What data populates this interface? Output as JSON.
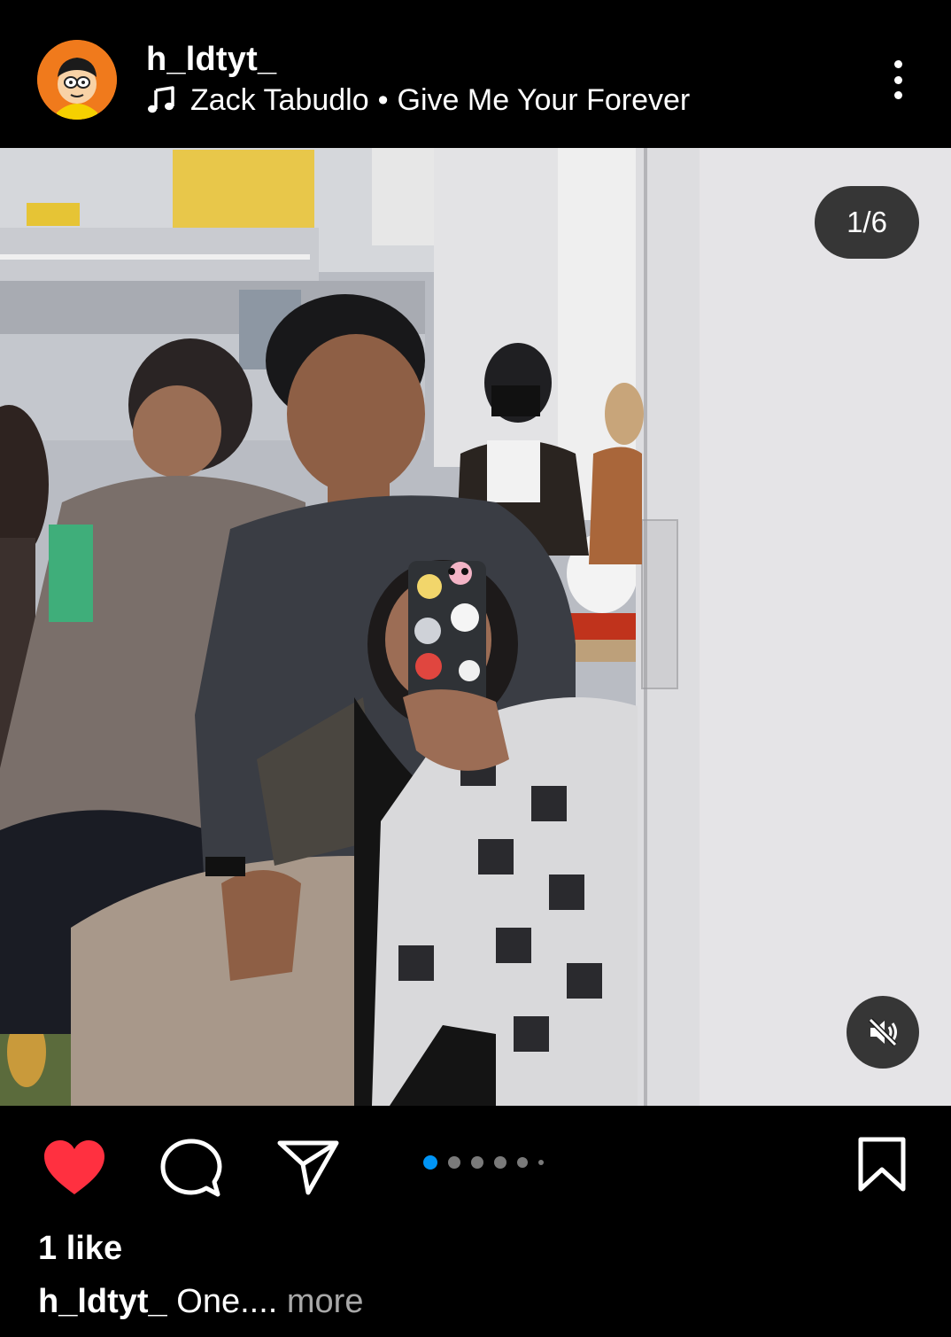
{
  "post": {
    "username": "h_ldtyt_",
    "music": {
      "artist": "Zack Tabudlo",
      "separator": "•",
      "song": "Give Me Your Forever"
    },
    "media": {
      "counter": "1/6",
      "current_index": 1,
      "total": 6
    },
    "likes_text": "1 like",
    "caption": {
      "username": "h_ldtyt_",
      "text": "One....",
      "more_label": "more"
    }
  },
  "icons": {
    "avatar": "avatar-cartoon",
    "music": "music-note-icon",
    "more": "more-vertical-icon",
    "mute": "muted-speaker-icon",
    "like": "heart-icon",
    "comment": "comment-icon",
    "share": "send-icon",
    "save": "bookmark-icon"
  },
  "colors": {
    "background": "#000000",
    "like_active": "#ff3040",
    "carousel_active": "#0095f6",
    "carousel_inactive": "#7a7a7a",
    "muted_text": "#a8a8a8",
    "avatar_bg": "#f07a1c"
  }
}
